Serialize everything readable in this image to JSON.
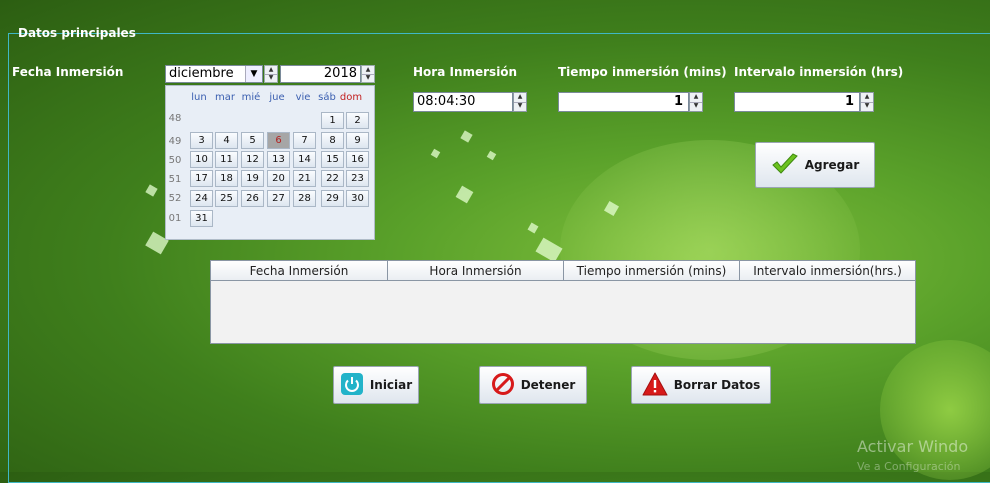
{
  "group_title": "Datos principales",
  "labels": {
    "fecha": "Fecha Inmersión",
    "hora": "Hora Inmersión",
    "tiempo": "Tiempo inmersión (mins)",
    "intervalo": "Intervalo inmersión (hrs)"
  },
  "calendar": {
    "month": "diciembre",
    "year": "2018",
    "weekdays": [
      "lun",
      "mar",
      "mié",
      "jue",
      "vie",
      "sáb",
      "dom"
    ],
    "week_numbers": [
      "48",
      "49",
      "50",
      "51",
      "52",
      "01"
    ],
    "days": [
      "1",
      "2",
      "3",
      "4",
      "5",
      "6",
      "7",
      "8",
      "9",
      "10",
      "11",
      "12",
      "13",
      "14",
      "15",
      "16",
      "17",
      "18",
      "19",
      "20",
      "21",
      "22",
      "23",
      "24",
      "25",
      "26",
      "27",
      "28",
      "29",
      "30",
      "31"
    ],
    "selected_day": "6"
  },
  "inputs": {
    "hora_value": "08:04:30",
    "tiempo_value": "1",
    "intervalo_value": "1"
  },
  "buttons": {
    "agregar": "Agregar",
    "iniciar": "Iniciar",
    "detener": "Detener",
    "borrar": "Borrar Datos"
  },
  "table": {
    "headers": [
      "Fecha Inmersión",
      "Hora Inmersión",
      "Tiempo inmersión (mins)",
      "Intervalo inmersión(hrs.)"
    ]
  },
  "watermark": {
    "line1": "Activar Windo",
    "line2": "Ve a Configuración"
  }
}
